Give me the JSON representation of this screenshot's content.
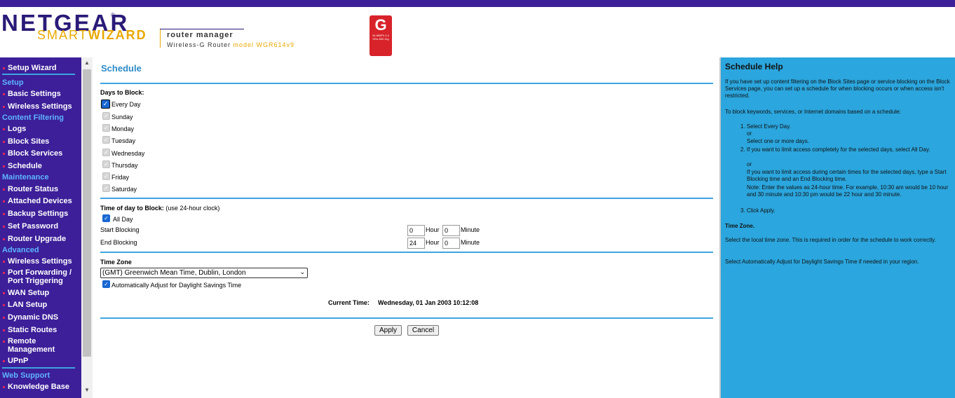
{
  "header": {
    "brand": "NETGEAR",
    "brand_reg": "®",
    "smart": "SMART",
    "wizard": "WIZARD",
    "router_manager": "router manager",
    "router_type": "Wireless-G Router",
    "model": "model WGR614v9",
    "badge_letter": "G",
    "badge_sub": "54 MBPS 2.4 GHz 802.11g"
  },
  "sidebar": {
    "items": [
      {
        "type": "item",
        "label": "Setup Wizard"
      },
      {
        "type": "head",
        "label": "Setup"
      },
      {
        "type": "item",
        "label": "Basic Settings"
      },
      {
        "type": "item",
        "label": "Wireless Settings"
      },
      {
        "type": "head",
        "label": "Content Filtering"
      },
      {
        "type": "item",
        "label": "Logs"
      },
      {
        "type": "item",
        "label": "Block Sites"
      },
      {
        "type": "item",
        "label": "Block Services"
      },
      {
        "type": "item",
        "label": "Schedule"
      },
      {
        "type": "head",
        "label": "Maintenance"
      },
      {
        "type": "item",
        "label": "Router Status"
      },
      {
        "type": "item",
        "label": "Attached Devices"
      },
      {
        "type": "item",
        "label": "Backup Settings"
      },
      {
        "type": "item",
        "label": "Set Password"
      },
      {
        "type": "item",
        "label": "Router Upgrade"
      },
      {
        "type": "head",
        "label": "Advanced"
      },
      {
        "type": "item",
        "label": "Wireless Settings"
      },
      {
        "type": "item",
        "label": "Port Forwarding /"
      },
      {
        "type": "item",
        "label": "Port Triggering"
      },
      {
        "type": "item",
        "label": "WAN Setup"
      },
      {
        "type": "item",
        "label": "LAN Setup"
      },
      {
        "type": "item",
        "label": "Dynamic DNS"
      },
      {
        "type": "item",
        "label": "Static Routes"
      },
      {
        "type": "item",
        "label": "Remote"
      },
      {
        "type": "item",
        "label": "Management"
      },
      {
        "type": "item",
        "label": "UPnP"
      },
      {
        "type": "head",
        "label": "Web Support"
      },
      {
        "type": "item",
        "label": "Knowledge Base"
      }
    ]
  },
  "main": {
    "title": "Schedule",
    "days_label": "Days to Block:",
    "every_day": "Every Day",
    "days": [
      "Sunday",
      "Monday",
      "Tuesday",
      "Wednesday",
      "Thursday",
      "Friday",
      "Saturday"
    ],
    "time_label": "Time of day to Block:",
    "time_note": "(use 24-hour clock)",
    "all_day": "All Day",
    "start_label": "Start Blocking",
    "end_label": "End Blocking",
    "hour_label": "Hour",
    "minute_label": "Minute",
    "start_hour": "0",
    "start_minute": "0",
    "end_hour": "24",
    "end_minute": "0",
    "tz_label": "Time Zone",
    "tz_value": "(GMT) Greenwich Mean Time, Dublin, London",
    "dst_label": "Automatically Adjust for Daylight Savings Time",
    "current_time_label": "Current Time:",
    "current_time_value": "Wednesday, 01 Jan 2003 10:12:08",
    "apply": "Apply",
    "cancel": "Cancel"
  },
  "help": {
    "title": "Schedule Help",
    "p1": "If you have set up content filtering on the Block Sites page or service blocking on the Block Services page, you can set up a schedule for when blocking occurs or when access isn't restricted.",
    "p2": "To block keywords, services, or Internet domains based on a schedule:",
    "s1a": "1. Select Every Day.",
    "s1b": "or",
    "s1c": "Select one or more days.",
    "s2a": "2. If you want to limit access completely for the selected days, select All Day.",
    "s2b": "or",
    "s2c": "If you want to limit access during certain times for the selected days, type a Start Blocking time and an End Blocking time.",
    "s2d": "Note: Enter the values as 24-hour time. For example, 10:30 am would be 10 hour and 30 minute and 10:30 pm would be 22 hour and 30 minute.",
    "s3": "3. Click Apply.",
    "tz_head": "Time Zone.",
    "p3": "Select the local time zone. This is required in order for the schedule to work correctly.",
    "p4": "Select Automatically Adjust for Daylight Savings Time if needed in your region."
  },
  "colors": {
    "nav_bg": "#3c1f99",
    "accent": "#3fa4e0",
    "help_bg": "#2ba6de",
    "brand_gold": "#e9a800",
    "badge_red": "#d8232a"
  }
}
